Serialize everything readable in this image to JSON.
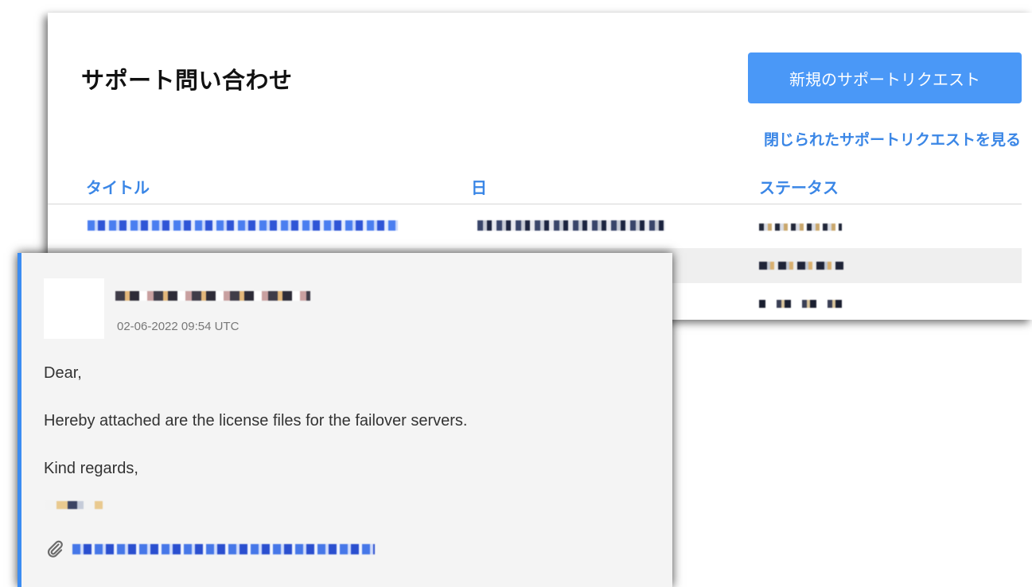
{
  "support": {
    "title": "サポート問い合わせ",
    "new_request_label": "新規のサポートリクエスト",
    "closed_link_label": "閉じられたサポートリクエストを見る",
    "columns": [
      "タイトル",
      "日",
      "ステータス"
    ],
    "rows": [
      {
        "title": "",
        "date": "",
        "status": ""
      },
      {
        "title": "",
        "date": "",
        "status": ""
      },
      {
        "title": "",
        "date": "",
        "status": ""
      }
    ]
  },
  "message": {
    "sender": "",
    "timestamp": "02-06-2022 09:54 UTC",
    "greeting": "Dear,",
    "body": "Hereby attached are the license files for the failover servers.",
    "closing": "Kind regards,",
    "attachment_icon": "paperclip-icon",
    "attachment_name": ""
  },
  "colors": {
    "accent": "#4a98f7",
    "link": "#3a86e6",
    "message_border": "#3b8cf2"
  }
}
